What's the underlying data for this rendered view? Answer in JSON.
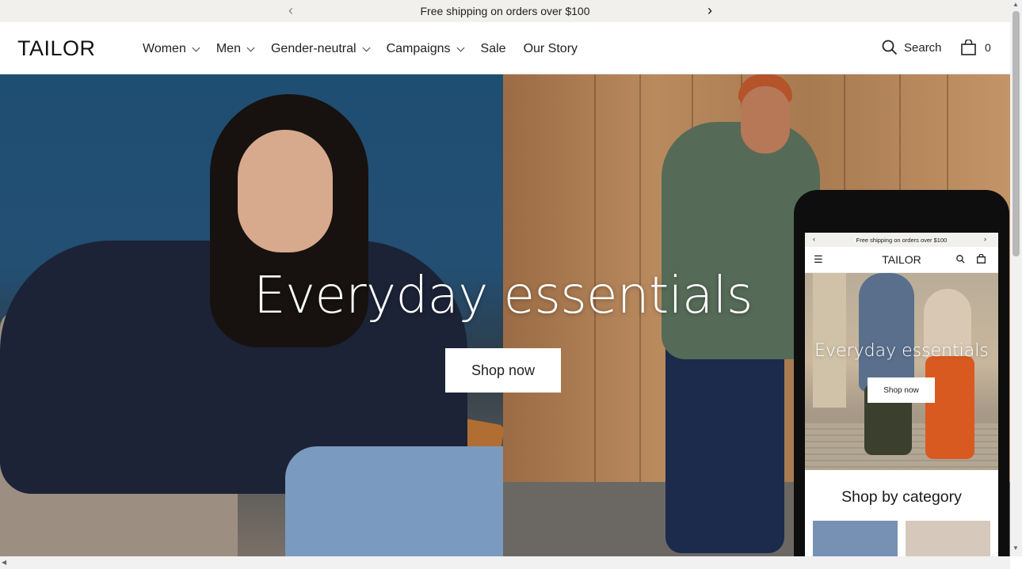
{
  "announcement": {
    "message": "Free shipping on orders over $100",
    "prev_icon": "chevron-left-icon",
    "next_icon": "chevron-right-icon"
  },
  "header": {
    "logo": "TAILOR",
    "nav": [
      {
        "label": "Women",
        "has_dropdown": true
      },
      {
        "label": "Men",
        "has_dropdown": true
      },
      {
        "label": "Gender-neutral",
        "has_dropdown": true
      },
      {
        "label": "Campaigns",
        "has_dropdown": true
      },
      {
        "label": "Sale",
        "has_dropdown": false
      },
      {
        "label": "Our Story",
        "has_dropdown": false
      }
    ],
    "search_label": "Search",
    "cart_count": "0"
  },
  "hero": {
    "title": "Everyday essentials",
    "button_label": "Shop now"
  },
  "mobile_preview": {
    "announcement": "Free shipping on orders over $100",
    "logo": "TAILOR",
    "hero_title": "Everyday essentials",
    "hero_button": "Shop now",
    "section_title": "Shop by category"
  },
  "colors": {
    "announcement_bg": "#f1f0ec",
    "text": "#1a1a1a",
    "button_bg": "#ffffff"
  }
}
